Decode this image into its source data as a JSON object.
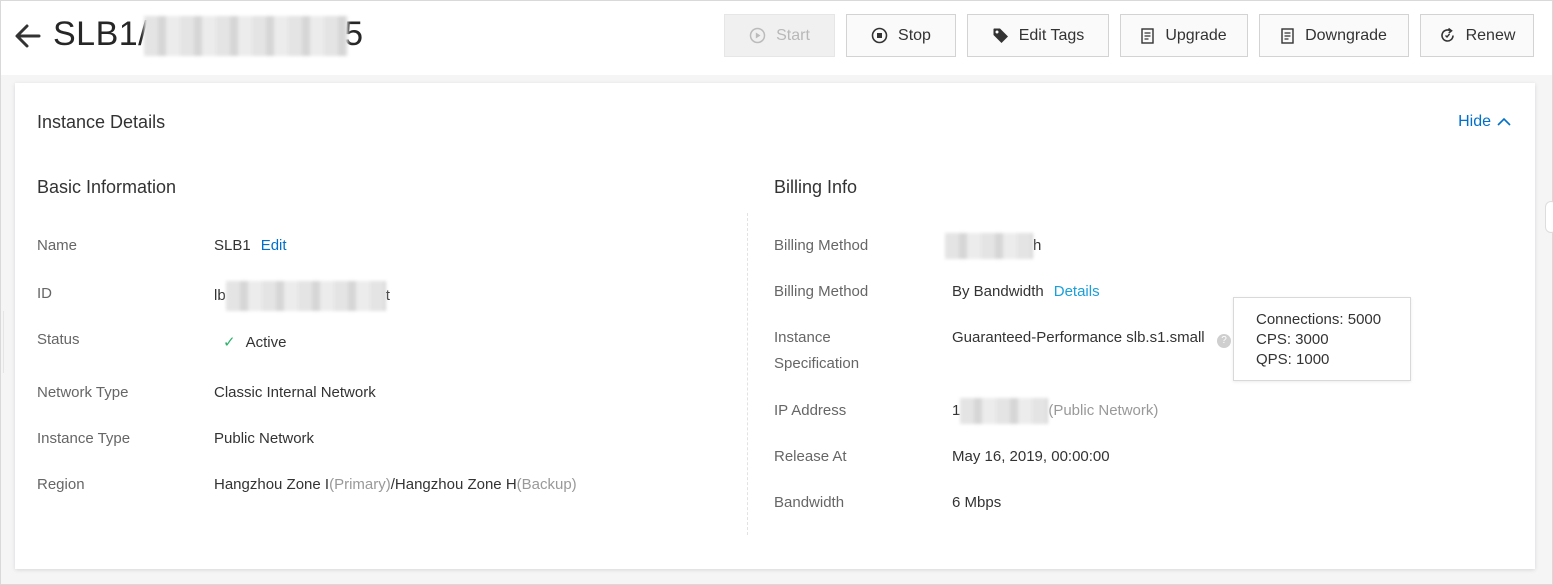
{
  "header": {
    "title_prefix": "SLB1/",
    "title_suffix": "5",
    "buttons": {
      "start": "Start",
      "stop": "Stop",
      "edit_tags": "Edit Tags",
      "upgrade": "Upgrade",
      "downgrade": "Downgrade",
      "renew": "Renew"
    }
  },
  "card": {
    "title": "Instance Details",
    "hide_label": "Hide"
  },
  "basic": {
    "title": "Basic Information",
    "name_label": "Name",
    "name_value": "SLB1",
    "name_edit": "Edit",
    "id_label": "ID",
    "id_prefix": "lb",
    "id_suffix": "t",
    "status_label": "Status",
    "status_value": "Active",
    "network_type_label": "Network Type",
    "network_type_value": "Classic Internal Network",
    "instance_type_label": "Instance Type",
    "instance_type_value": "Public Network",
    "region_label": "Region",
    "region_primary": "Hangzhou Zone I",
    "region_primary_tag": "(Primary)",
    "region_sep": "/",
    "region_backup": "Hangzhou Zone H",
    "region_backup_tag": "(Backup)"
  },
  "billing": {
    "title": "Billing Info",
    "method1_label": "Billing Method",
    "method1_suffix": "h",
    "method2_label": "Billing Method",
    "method2_value": "By Bandwidth",
    "method2_link": "Details",
    "spec_label_1": "Instance",
    "spec_label_2": "Specification",
    "spec_value": "Guaranteed-Performance slb.s1.small",
    "ip_label": "IP Address",
    "ip_prefix": "1",
    "ip_tag": "(Public Network)",
    "release_label": "Release At",
    "release_value": "May 16, 2019, 00:00:00",
    "bandwidth_label": "Bandwidth",
    "bandwidth_value": "6 Mbps"
  },
  "tooltip": {
    "line1": "Connections: 5000",
    "line2": "CPS: 3000",
    "line3": "QPS: 1000"
  },
  "colors": {
    "link": "#0070cc",
    "success": "#2db36c"
  }
}
